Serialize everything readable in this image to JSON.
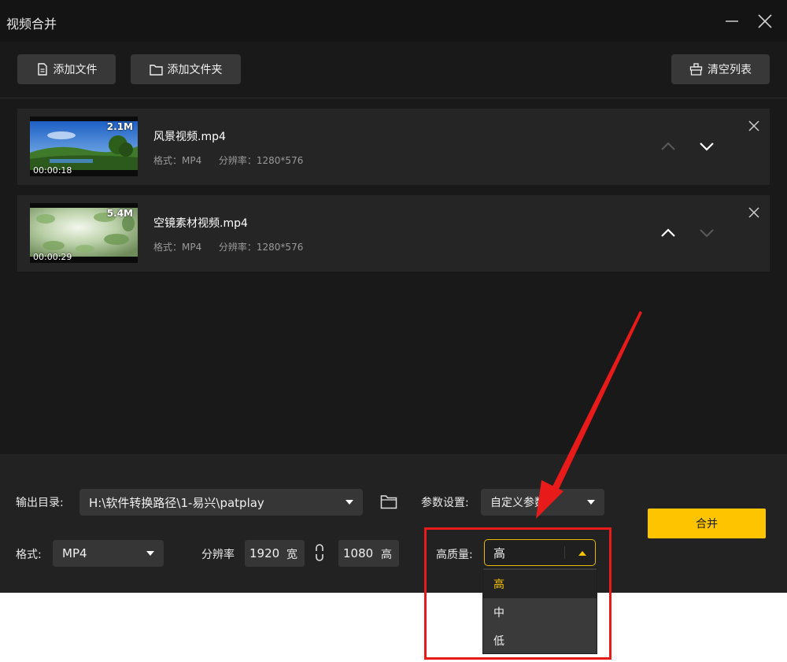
{
  "window": {
    "title": "视频合并"
  },
  "toolbar": {
    "add_file": "添加文件",
    "add_folder": "添加文件夹",
    "clear_list": "清空列表"
  },
  "files": [
    {
      "name": "风景视频.mp4",
      "format_label": "格式：MP4",
      "resolution_label": "分辨率：1280*576",
      "size": "2.1M",
      "duration": "00:00:18"
    },
    {
      "name": "空镜素材视频.mp4",
      "format_label": "格式：MP4",
      "resolution_label": "分辨率：1280*576",
      "size": "5.4M",
      "duration": "00:00:29"
    }
  ],
  "settings": {
    "output_label": "输出目录:",
    "output_path": "H:\\软件转换路径\\1-易兴\\patplay",
    "params_label": "参数设置:",
    "params_value": "自定义参数",
    "format_label": "格式:",
    "format_value": "MP4",
    "resolution_label": "分辨率",
    "width": "1920",
    "width_unit": "宽",
    "height": "1080",
    "height_unit": "高",
    "quality_label": "高质量:",
    "quality_value": "高",
    "quality_options": [
      "高",
      "中",
      "低"
    ]
  },
  "actions": {
    "merge": "合并"
  },
  "colors": {
    "accent": "#ffc400",
    "annotation": "#e81a1a",
    "background": "#191919"
  }
}
